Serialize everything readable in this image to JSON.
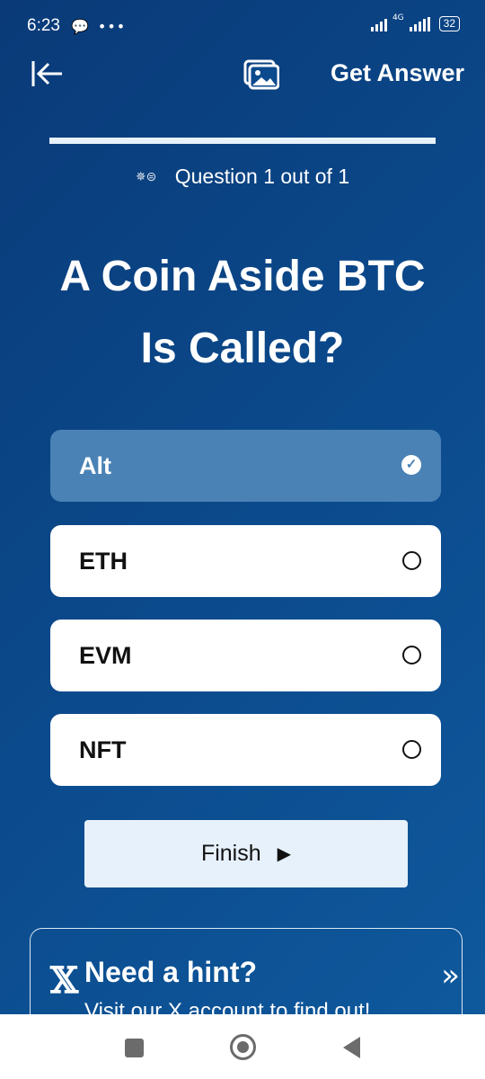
{
  "status_bar": {
    "time": "6:23",
    "network": "4G",
    "battery": "32"
  },
  "header": {
    "back_icon": "back-arrow-icon",
    "image_icon": "image-gallery-icon",
    "get_answer_label": "Get Answer"
  },
  "progress": {
    "fraction": 1.0
  },
  "question": {
    "counter": "Question 1 out of 1",
    "counter_icon": "coin-flame-icon",
    "title": "A Coin Aside BTC Is Called?"
  },
  "options": [
    {
      "label": "Alt",
      "selected": true
    },
    {
      "label": "ETH",
      "selected": false
    },
    {
      "label": "EVM",
      "selected": false
    },
    {
      "label": "NFT",
      "selected": false
    }
  ],
  "finish": {
    "label": "Finish",
    "icon": "play-icon"
  },
  "hint": {
    "icon": "x-logo",
    "title": "Need a hint?",
    "subtitle": "Visit our X account to find out!",
    "arrow_icon": "double-chevron-right-icon"
  },
  "colors": {
    "background": "#0b4a8c",
    "selected_option": "#4a82b5",
    "finish_button": "#e6f1fb"
  }
}
